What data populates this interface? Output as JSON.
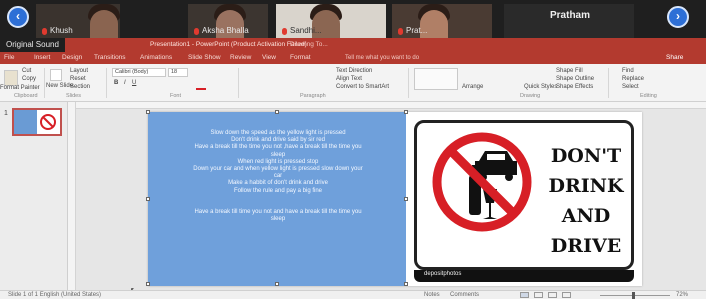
{
  "video_call": {
    "participants": [
      {
        "name": "Khush"
      },
      {
        "name": "Aksha Bhalla"
      },
      {
        "name": "Sandhi..."
      },
      {
        "name": "Prat..."
      }
    ],
    "speaker_name": "Pratham",
    "mic_color": "#e03a2f",
    "accent_color": "#2d6fd6"
  },
  "sound_label": "Original Sound",
  "app": {
    "window_title": "Presentation1 - PowerPoint (Product Activation Failed)",
    "title_right": "Drawing To...",
    "brand_color": "#b33a2f",
    "tabs": [
      "File",
      "Insert",
      "Design",
      "Transitions",
      "Animations",
      "Slide Show",
      "Review",
      "View",
      "Format"
    ],
    "tell_me": "Tell me what you want to do",
    "share_label": "Share"
  },
  "ribbon": {
    "groups": [
      "Clipboard",
      "Slides",
      "Font",
      "Paragraph",
      "Drawing",
      "Editing"
    ],
    "clipboard": {
      "cut": "Cut",
      "copy": "Copy",
      "format_painter": "Format Painter"
    },
    "slides": {
      "new_slide": "New Slide",
      "layout": "Layout",
      "reset": "Reset",
      "section": "Section"
    },
    "font": {
      "name": "Calibri (Body)",
      "size": "18"
    },
    "paragraph": {
      "text_direction": "Text Direction",
      "align_text": "Align Text",
      "smartart": "Convert to SmartArt"
    },
    "drawing": {
      "arrange": "Arrange",
      "quick_styles": "Quick Styles",
      "shape_fill": "Shape Fill",
      "shape_outline": "Shape Outline",
      "shape_effects": "Shape Effects"
    },
    "editing": {
      "find": "Find",
      "replace": "Replace",
      "select": "Select"
    }
  },
  "thumbnail": {
    "slide_number": "1"
  },
  "slide": {
    "text_color": "#6fa0db",
    "lines": [
      "Slow down the speed as the yellow light is pressed",
      "Don't drink and drive said by sir red",
      "Have a break till the time you not ,have a break till the time you",
      "sleep",
      "When red light is pressed stop",
      "Down your car and when yellow light is pressed slow down your",
      "car",
      "Make a habbit of don't drink and drive",
      "Follow the rule and pay a big fine",
      "",
      "",
      "Have a break till time you not and have a break till the time you",
      "sleep"
    ],
    "sign": {
      "words": [
        "DON'T",
        "DRINK",
        "AND",
        "DRIVE"
      ],
      "footer": "depositphotos",
      "red_color": "#d71f26"
    }
  },
  "status": {
    "slide_info": "Slide 1 of 1   English (United States)",
    "notes": "Notes",
    "comments": "Comments",
    "zoom": "72%"
  }
}
